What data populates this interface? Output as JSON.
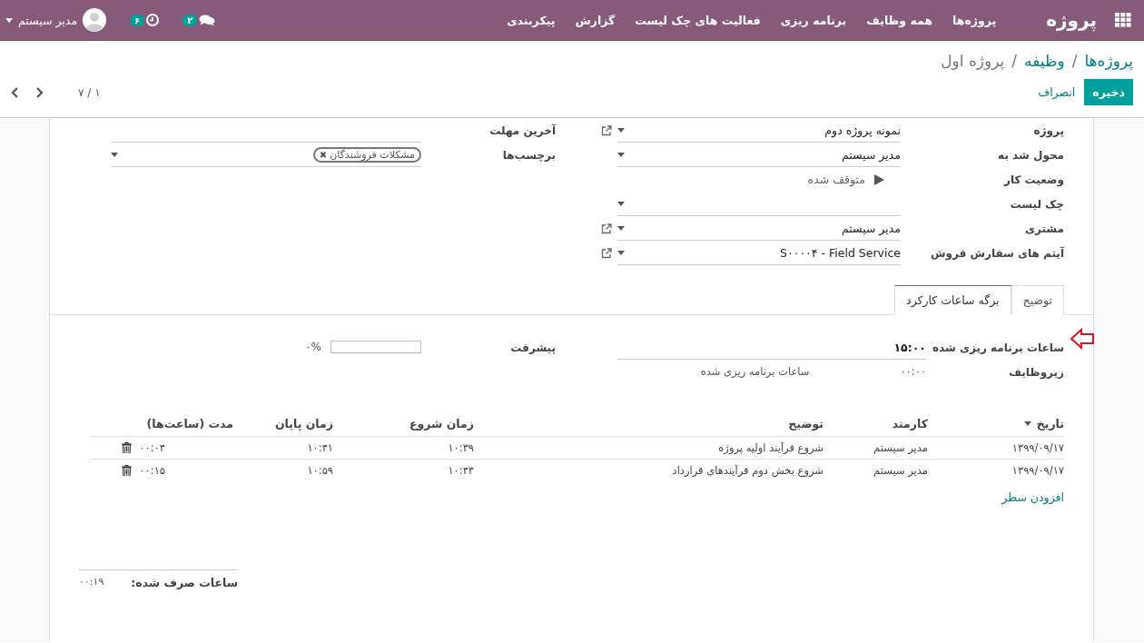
{
  "navbar": {
    "app_title": "پروژه",
    "menu": [
      "پروژه‌ها",
      "همه وظایف",
      "برنامه ریزی",
      "فعالیت های چک لیست",
      "گزارش",
      "پیکربندی"
    ],
    "messages_count": "۲",
    "activities_count": "۶",
    "user": "مدیر سیستم"
  },
  "breadcrumb": [
    "پروژه‌ها",
    "وظیفه",
    "پروژه اول"
  ],
  "breadcrumb_separators": [
    "/",
    "/"
  ],
  "buttons": {
    "save": "ذخیره",
    "discard": "انصراف"
  },
  "pager": "۱ / ۷",
  "form": {
    "right_fields": [
      {
        "label": "پروژه",
        "kind": "select",
        "value": "نمونه پروژه دوم",
        "external": true
      },
      {
        "label": "محول شد به",
        "kind": "select",
        "value": "مدیر سیستم",
        "external": false
      },
      {
        "label": "وضعیت کار",
        "kind": "timer",
        "value": "متوقف شده",
        "external": false
      },
      {
        "label": "چک لیست",
        "kind": "select",
        "external": false
      },
      {
        "label": "مشتری",
        "kind": "select",
        "value": "مدیر سیستم",
        "external": true
      },
      {
        "label": "آیتم های سفارش فروش",
        "kind": "select",
        "value": "S۰۰۰۰۴ - Field Service",
        "external": true
      }
    ],
    "left_fields": [
      {
        "label": "آخرین مهلت",
        "kind": "date"
      },
      {
        "label": "برچسب‌ها",
        "kind": "tags",
        "tags": [
          {
            "label": "مشکلات فروشندگان",
            "remove": "✖"
          }
        ]
      }
    ],
    "tabs": [
      {
        "label": "توضیح",
        "selected": false
      },
      {
        "label": "برگه ساعات کارکرد",
        "selected": true
      }
    ],
    "timesheet": {
      "planned_label": "ساعات برنامه ریزی شده",
      "planned_value": "۱۵:۰۰",
      "subtasks_label": "زیروظایف",
      "subtasks_value": "۰۰:۰۰",
      "subtasks_note": "ساعات برنامه ریزی شده",
      "progress_label": "پیشرفت",
      "progress": {
        "level": 0,
        "reading": "۰%"
      },
      "table": {
        "columns": [
          {
            "label": "تاریخ",
            "sorted": true
          },
          {
            "label": "کارمند",
            "sorted": false
          },
          {
            "label": "توضیح",
            "sorted": false
          },
          {
            "label": "زمان شروع",
            "sorted": false
          },
          {
            "label": "زمان پایان",
            "sorted": false
          },
          {
            "label": "مدت (ساعت‌ها)",
            "sorted": false
          }
        ],
        "rows": [
          [
            "۱۳۹۹/۰۹/۱۷",
            "مدیر سیستم",
            "شروع فرآیند اولیه پروژه",
            "۱۰:۳۹",
            "۱۰:۴۱",
            "۰۰:۰۴"
          ],
          [
            "۱۳۹۹/۰۹/۱۷",
            "مدیر سیستم",
            "شروع بخش دوم فرآیندهای قرارداد",
            "۱۰:۴۳",
            "۱۰:۵۹",
            "۰۰:۱۵"
          ]
        ],
        "add_line": "افزودن سطر"
      },
      "total_label": "ساعات صرف شده:",
      "total_value": "۰۰:۱۹"
    }
  }
}
